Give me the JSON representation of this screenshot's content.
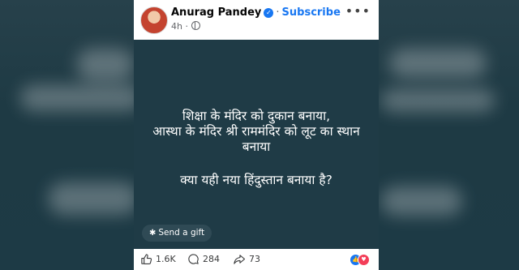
{
  "author": {
    "name": "Anurag Pandey",
    "subscribe_label": "Subscribe",
    "time": "4h"
  },
  "post": {
    "lines": [
      "शिक्षा के मंदिर को दुकान बनाया,",
      "आस्था के मंदिर श्री राममंदिर को लूट का स्थान",
      "बनाया"
    ],
    "question": "क्या यही नया हिंदुस्तान बनाया है?"
  },
  "gift": {
    "label": "Send a gift"
  },
  "actions": {
    "likes": "1.6K",
    "comments": "284",
    "shares": "73"
  },
  "colors": {
    "image_bg": "#1f3b46",
    "accent": "#1877f2",
    "love": "#f33e58"
  },
  "icons": [
    "verified-badge-icon",
    "globe-icon",
    "more-options-icon",
    "gift-icon",
    "like-icon",
    "comment-icon",
    "share-icon",
    "like-reaction-icon",
    "love-reaction-icon"
  ]
}
